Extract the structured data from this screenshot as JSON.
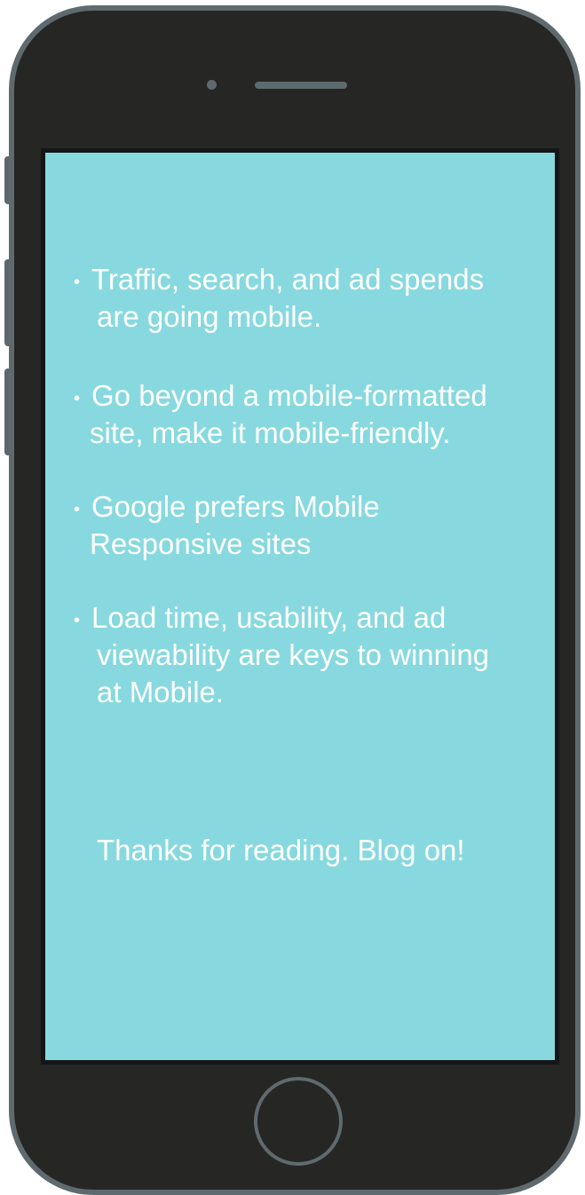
{
  "slide": {
    "bullets": [
      {
        "marker": "•",
        "lines": [
          "Traffic, search, and ad spends",
          "are going mobile."
        ]
      },
      {
        "marker": "•",
        "lines": [
          "Go beyond a mobile-formatted",
          "site, make it mobile-friendly."
        ]
      },
      {
        "marker": "•",
        "lines": [
          "Google prefers Mobile",
          "Responsive sites"
        ]
      },
      {
        "marker": "•",
        "lines": [
          "Load time, usability, and ad",
          "viewability are keys to winning",
          "at Mobile."
        ]
      }
    ],
    "closing": "Thanks for reading. Blog on!"
  },
  "colors": {
    "screen_background": "#87d9df",
    "phone_body": "#262624",
    "phone_trim": "#5f6a6e",
    "text": "#ffffff"
  }
}
